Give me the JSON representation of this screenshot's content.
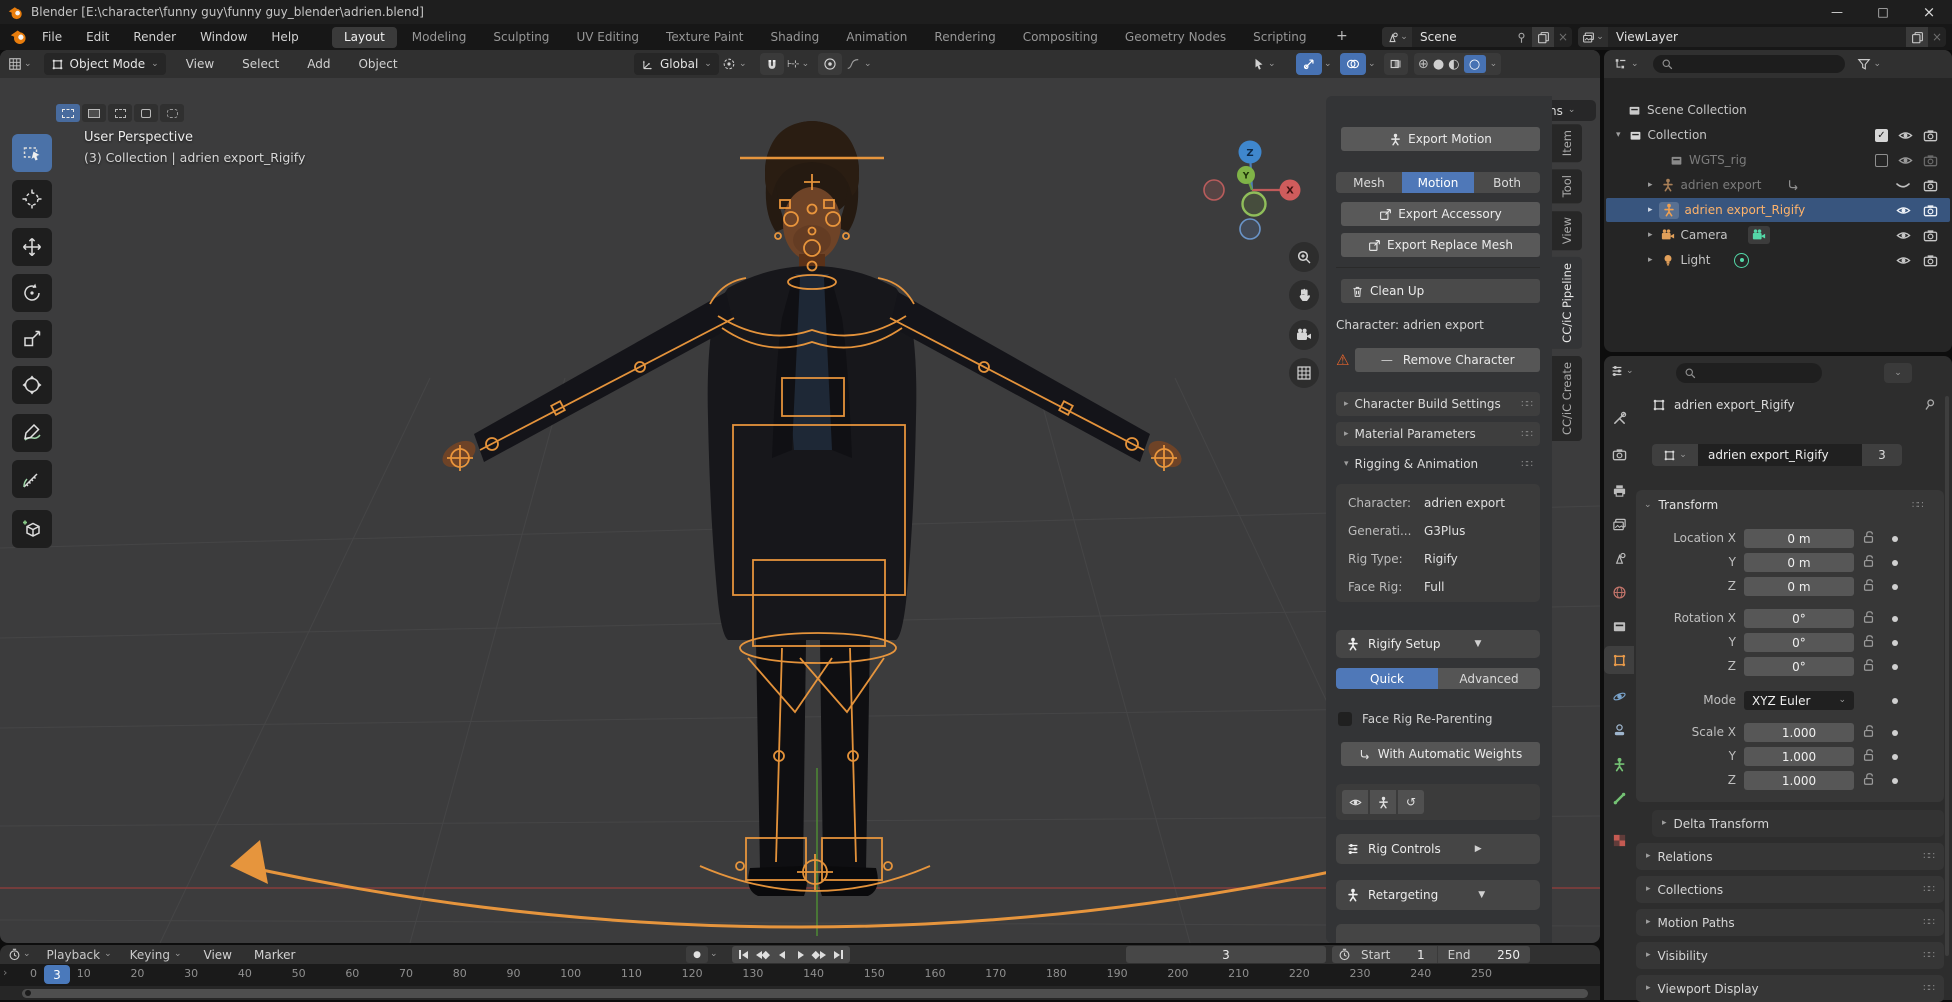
{
  "window": {
    "title": "Blender [E:\\character\\funny guy\\funny guy_blender\\adrien.blend]"
  },
  "icons": {
    "caret_down": "⌄",
    "caret_right": "▸",
    "caret_expand": "▾",
    "dropdown_tri": "▼",
    "play_tri": "▶",
    "warning": "⚠",
    "minus": "—",
    "undo": "↺",
    "check": "✓",
    "close": "×",
    "dots": "∷∷",
    "plus": "+",
    "record": "●",
    "chevron": "›",
    "minimize": "—",
    "maximize": "□",
    "wire_sphere": "⊕",
    "solid_sphere": "●",
    "material_sphere": "◐",
    "rendered_sphere": "○"
  },
  "colors": {
    "accent": "#4772b3",
    "rig_orange": "#f09a3e",
    "selected_row": "#38557e",
    "active_object_text": "#ffb36a"
  },
  "topbar": {
    "menus": [
      "File",
      "Edit",
      "Render",
      "Window",
      "Help"
    ],
    "tabs": [
      {
        "label": "Layout",
        "active": true
      },
      {
        "label": "Modeling"
      },
      {
        "label": "Sculpting"
      },
      {
        "label": "UV Editing"
      },
      {
        "label": "Texture Paint"
      },
      {
        "label": "Shading"
      },
      {
        "label": "Animation"
      },
      {
        "label": "Rendering"
      },
      {
        "label": "Compositing"
      },
      {
        "label": "Geometry Nodes"
      },
      {
        "label": "Scripting"
      }
    ],
    "add_tab": "+",
    "scene": "Scene",
    "viewlayer": "ViewLayer"
  },
  "vph": {
    "mode": "Object Mode",
    "menus": [
      "View",
      "Select",
      "Add",
      "Object"
    ],
    "orientation": "Global",
    "options": "Options"
  },
  "viewport": {
    "view_label": "User Perspective",
    "context": "(3) Collection | adrien export_Rigify",
    "axis_x": "X",
    "axis_y": "Y",
    "axis_z": "Z"
  },
  "npanel": {
    "tabs": [
      {
        "label": "Item"
      },
      {
        "label": "Tool"
      },
      {
        "label": "View"
      },
      {
        "label": "CC/iC Pipeline",
        "active": true
      },
      {
        "label": "CC/iC Create"
      }
    ],
    "export_motion": "Export Motion",
    "mesh": "Mesh",
    "motion": "Motion",
    "both": "Both",
    "export_accessory": "Export Accessory",
    "export_replace": "Export Replace Mesh",
    "clean_up": "Clean Up",
    "character_line": "Character: adrien export",
    "remove_character": "Remove Character",
    "sec_build": "Character Build Settings",
    "sec_material": "Material Parameters",
    "sec_rigging": "Rigging & Animation",
    "info": [
      {
        "label": "Character:",
        "value": "adrien export"
      },
      {
        "label": "Generati...",
        "value": "G3Plus"
      },
      {
        "label": "Rig Type:",
        "value": "Rigify"
      },
      {
        "label": "Face Rig:",
        "value": "Full"
      }
    ],
    "rigify_setup": "Rigify Setup",
    "quick": "Quick",
    "advanced": "Advanced",
    "face_rig": "Face Rig Re-Parenting",
    "auto_weights": "With Automatic Weights",
    "rig_controls": "Rig Controls",
    "retargeting": "Retargeting"
  },
  "outliner": {
    "rows": [
      {
        "label": "Scene Collection"
      },
      {
        "label": "Collection"
      },
      {
        "label": "WGTS_rig"
      },
      {
        "label": "adrien export"
      },
      {
        "label": "adrien export_Rigify"
      },
      {
        "label": "Camera"
      },
      {
        "label": "Light"
      }
    ]
  },
  "properties": {
    "breadcrumb": "adrien export_Rigify",
    "name": "adrien export_Rigify",
    "users": "3",
    "transform_title": "Transform",
    "rows": [
      {
        "label": "Location X",
        "value": "0 m"
      },
      {
        "label": "Y",
        "value": "0 m"
      },
      {
        "label": "Z",
        "value": "0 m"
      },
      {
        "label": "Rotation X",
        "value": "0°"
      },
      {
        "label": "Y",
        "value": "0°"
      },
      {
        "label": "Z",
        "value": "0°"
      },
      {
        "label": "Mode",
        "value": "XYZ Euler"
      },
      {
        "label": "Scale X",
        "value": "1.000"
      },
      {
        "label": "Y",
        "value": "1.000"
      },
      {
        "label": "Z",
        "value": "1.000"
      }
    ],
    "sections": [
      {
        "label": "Delta Transform",
        "delta": true
      },
      {
        "label": "Relations"
      },
      {
        "label": "Collections"
      },
      {
        "label": "Motion Paths"
      },
      {
        "label": "Visibility"
      },
      {
        "label": "Viewport Display"
      }
    ]
  },
  "timeline": {
    "menus": [
      "Playback",
      "Keying",
      "View",
      "Marker"
    ],
    "frame": "3",
    "current": "3",
    "start_label": "Start",
    "start": "1",
    "end_label": "End",
    "end": "250",
    "ticks": [
      "0",
      "10",
      "20",
      "30",
      "40",
      "50",
      "60",
      "70",
      "80",
      "90",
      "100",
      "110",
      "120",
      "130",
      "140",
      "150",
      "160",
      "170",
      "180",
      "190",
      "200",
      "210",
      "220",
      "230",
      "240",
      "250"
    ]
  }
}
